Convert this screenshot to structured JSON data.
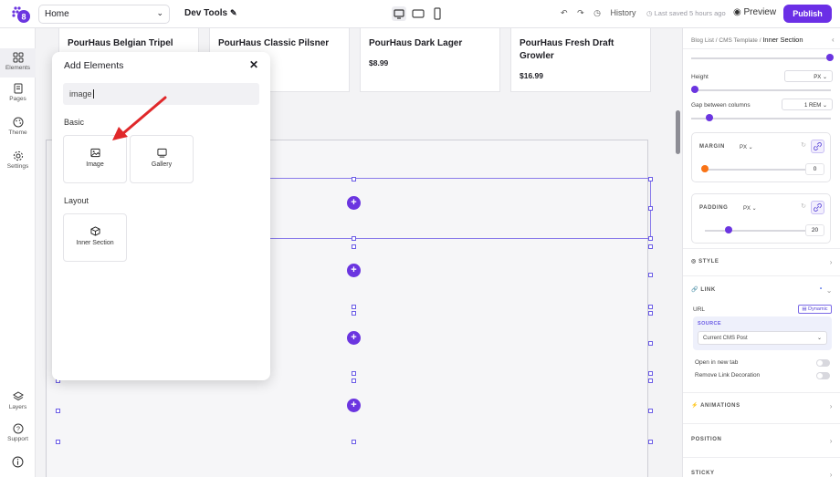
{
  "topbar": {
    "page": "Home",
    "project": "Dev Tools",
    "history": "History",
    "saved": "Last saved 5 hours ago",
    "preview": "Preview",
    "publish": "Publish"
  },
  "leftbar": {
    "elements": "Elements",
    "pages": "Pages",
    "theme": "Theme",
    "settings": "Settings",
    "layers": "Layers",
    "support": "Support"
  },
  "canvas": {
    "products": [
      {
        "name": "PourHaus Belgian Tripel",
        "price": ""
      },
      {
        "name": "PourHaus Classic Pilsner",
        "price": ""
      },
      {
        "name": "PourHaus Dark Lager",
        "price": "$8.99"
      },
      {
        "name": "PourHaus Fresh Draft Growler",
        "price": "$16.99"
      }
    ],
    "plus": "+"
  },
  "modal": {
    "title": "Add Elements",
    "close": "✕",
    "search_value": "image",
    "basic_label": "Basic",
    "layout_label": "Layout",
    "tiles": {
      "image": "Image",
      "gallery": "Gallery",
      "inner_section": "Inner Section"
    }
  },
  "panel": {
    "breadcrumb": {
      "a": "Blog List",
      "sep": "/",
      "b": "CMS Template",
      "c": "Inner Section"
    },
    "height_label": "Height",
    "height_unit": "PX",
    "gap_label": "Gap between columns",
    "gap_value": "1",
    "gap_unit": "REM",
    "margin": {
      "title": "MARGIN",
      "unit": "PX",
      "value": "0"
    },
    "padding": {
      "title": "PADDING",
      "unit": "PX",
      "value": "20"
    },
    "style": "STYLE",
    "link": "LINK",
    "url": "URL",
    "dynamic": "Dynamic",
    "source_label": "SOURCE",
    "source_value": "Current CMS Post",
    "open_new_tab": "Open in new tab",
    "remove_decoration": "Remove Link Decoration",
    "animations": "ANIMATIONS",
    "position": "POSITION",
    "sticky": "STICKY"
  },
  "colors": {
    "accent": "#6b35e0",
    "annotation": "#e0282a",
    "orange": "#f97316"
  }
}
